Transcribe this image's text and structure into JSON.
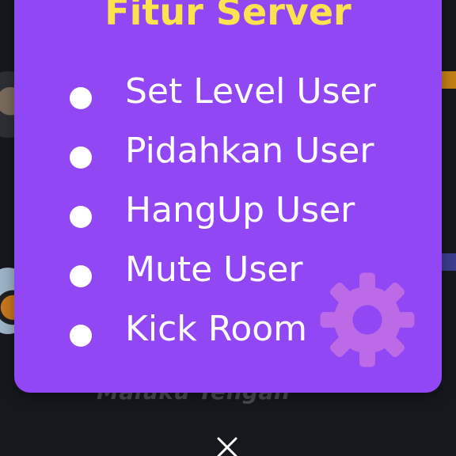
{
  "modal": {
    "title": "Fitur Server",
    "features": [
      {
        "label": "Set Level User"
      },
      {
        "label": "Pidahkan User"
      },
      {
        "label": "HangUp User"
      },
      {
        "label": "Mute User"
      },
      {
        "label": "Kick Room"
      }
    ]
  },
  "background": {
    "subtitle": "Maluku Tengah"
  },
  "icons": {
    "decor": "gear-icon",
    "close": "close-icon",
    "bullet": "bullet-dot"
  },
  "colors": {
    "modal_bg": "#9148f4",
    "title": "#fde24f",
    "text": "#ffffff",
    "page_bg": "#16181e"
  }
}
